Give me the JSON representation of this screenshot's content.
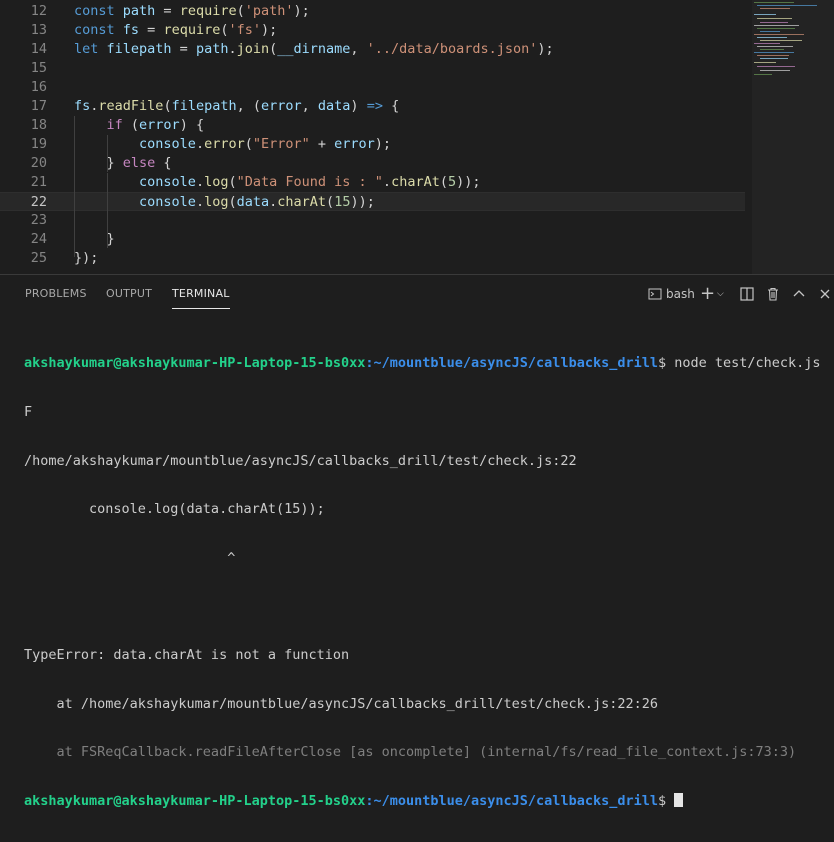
{
  "editor": {
    "lines": [
      {
        "num": "12",
        "tokens": [
          [
            "kw",
            "const "
          ],
          [
            "var",
            "path"
          ],
          [
            "pun",
            " = "
          ],
          [
            "fn",
            "require"
          ],
          [
            "pun",
            "("
          ],
          [
            "str",
            "'path'"
          ],
          [
            "pun",
            ");"
          ]
        ]
      },
      {
        "num": "13",
        "tokens": [
          [
            "kw",
            "const "
          ],
          [
            "var",
            "fs"
          ],
          [
            "pun",
            " = "
          ],
          [
            "fn",
            "require"
          ],
          [
            "pun",
            "("
          ],
          [
            "str",
            "'fs'"
          ],
          [
            "pun",
            ");"
          ]
        ]
      },
      {
        "num": "14",
        "tokens": [
          [
            "kw",
            "let "
          ],
          [
            "var",
            "filepath"
          ],
          [
            "pun",
            " = "
          ],
          [
            "var",
            "path"
          ],
          [
            "pun",
            "."
          ],
          [
            "fn",
            "join"
          ],
          [
            "pun",
            "("
          ],
          [
            "var",
            "__dirname"
          ],
          [
            "pun",
            ", "
          ],
          [
            "str",
            "'../data/boards.json'"
          ],
          [
            "pun",
            ");"
          ]
        ]
      },
      {
        "num": "15",
        "tokens": []
      },
      {
        "num": "16",
        "tokens": []
      },
      {
        "num": "17",
        "tokens": [
          [
            "var",
            "fs"
          ],
          [
            "pun",
            "."
          ],
          [
            "fn",
            "readFile"
          ],
          [
            "pun",
            "("
          ],
          [
            "var",
            "filepath"
          ],
          [
            "pun",
            ", ("
          ],
          [
            "var",
            "error"
          ],
          [
            "pun",
            ", "
          ],
          [
            "var",
            "data"
          ],
          [
            "pun",
            ") "
          ],
          [
            "kw",
            "=>"
          ],
          [
            "pun",
            " {"
          ]
        ]
      },
      {
        "num": "18",
        "tokens": [
          [
            "pun",
            "    "
          ],
          [
            "kwc",
            "if"
          ],
          [
            "pun",
            " ("
          ],
          [
            "var",
            "error"
          ],
          [
            "pun",
            ") {"
          ]
        ]
      },
      {
        "num": "19",
        "tokens": [
          [
            "pun",
            "        "
          ],
          [
            "var",
            "console"
          ],
          [
            "pun",
            "."
          ],
          [
            "fn",
            "error"
          ],
          [
            "pun",
            "("
          ],
          [
            "str",
            "\"Error\""
          ],
          [
            "pun",
            " + "
          ],
          [
            "var",
            "error"
          ],
          [
            "pun",
            ");"
          ]
        ]
      },
      {
        "num": "20",
        "tokens": [
          [
            "pun",
            "    } "
          ],
          [
            "kwc",
            "else"
          ],
          [
            "pun",
            " {"
          ]
        ]
      },
      {
        "num": "21",
        "tokens": [
          [
            "pun",
            "        "
          ],
          [
            "var",
            "console"
          ],
          [
            "pun",
            "."
          ],
          [
            "fn",
            "log"
          ],
          [
            "pun",
            "("
          ],
          [
            "str",
            "\"Data Found is : \""
          ],
          [
            "pun",
            "."
          ],
          [
            "fn",
            "charAt"
          ],
          [
            "pun",
            "("
          ],
          [
            "num",
            "5"
          ],
          [
            "pun",
            "));"
          ]
        ]
      },
      {
        "num": "22",
        "tokens": [
          [
            "pun",
            "        "
          ],
          [
            "var",
            "console"
          ],
          [
            "pun",
            "."
          ],
          [
            "fn",
            "log"
          ],
          [
            "pun",
            "("
          ],
          [
            "var",
            "data"
          ],
          [
            "pun",
            "."
          ],
          [
            "fn",
            "charAt"
          ],
          [
            "pun",
            "("
          ],
          [
            "num",
            "15"
          ],
          [
            "pun",
            "));"
          ]
        ]
      },
      {
        "num": "23",
        "tokens": []
      },
      {
        "num": "24",
        "tokens": [
          [
            "pun",
            "    }"
          ]
        ]
      },
      {
        "num": "25",
        "tokens": [
          [
            "pun",
            "});"
          ]
        ]
      }
    ],
    "current_line": "22"
  },
  "panel": {
    "tabs": [
      "PROBLEMS",
      "OUTPUT",
      "TERMINAL"
    ],
    "active_tab": "TERMINAL",
    "shell_label": "bash",
    "toolbar_icons": [
      "terminal-icon",
      "plus-icon",
      "chevron-down-icon",
      "split-icon",
      "trash-icon",
      "chevron-up-icon",
      "close-icon"
    ]
  },
  "terminal": {
    "prompt_user": "akshaykumar@akshaykumar-HP-Laptop-15-bs0xx",
    "prompt_path": ":~/mountblue/asyncJS/callbacks_drill",
    "command": "$ node test/check.js",
    "output": [
      "F",
      "/home/akshaykumar/mountblue/asyncJS/callbacks_drill/test/check.js:22",
      "        console.log(data.charAt(15));",
      "                         ^",
      "",
      "TypeError: data.charAt is not a function",
      "    at /home/akshaykumar/mountblue/asyncJS/callbacks_drill/test/check.js:22:26"
    ],
    "dim_line": "    at FSReqCallback.readFileAfterClose [as oncomplete] (internal/fs/read_file_context.js:73:3)",
    "last_prompt_user": "akshaykumar@akshaykumar-HP-Laptop-15-bs0xx",
    "last_prompt_path": ":~/mountblue/asyncJS/callbacks_drill",
    "last_prompt_end": "$ "
  }
}
